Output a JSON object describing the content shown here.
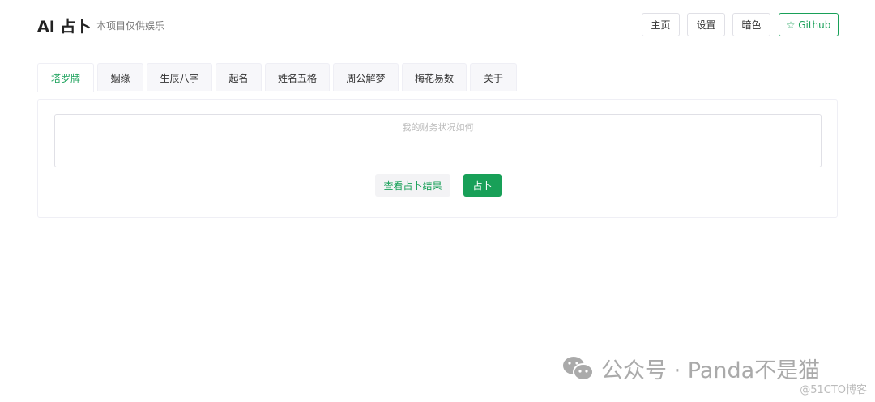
{
  "header": {
    "title": "AI 占卜",
    "subtitle": "本项目仅供娱乐",
    "buttons": {
      "home": "主页",
      "settings": "设置",
      "dark": "暗色",
      "github": "☆ Github"
    }
  },
  "tabs": [
    "塔罗牌",
    "姻缘",
    "生辰八字",
    "起名",
    "姓名五格",
    "周公解梦",
    "梅花易数",
    "关于"
  ],
  "main": {
    "placeholder": "我的财务状况如何",
    "view_result": "查看占卜结果",
    "divine": "占卜"
  },
  "watermark": {
    "text": "公众号 · Panda不是猫",
    "source": "@51CTO博客"
  },
  "colors": {
    "accent": "#18a058"
  }
}
